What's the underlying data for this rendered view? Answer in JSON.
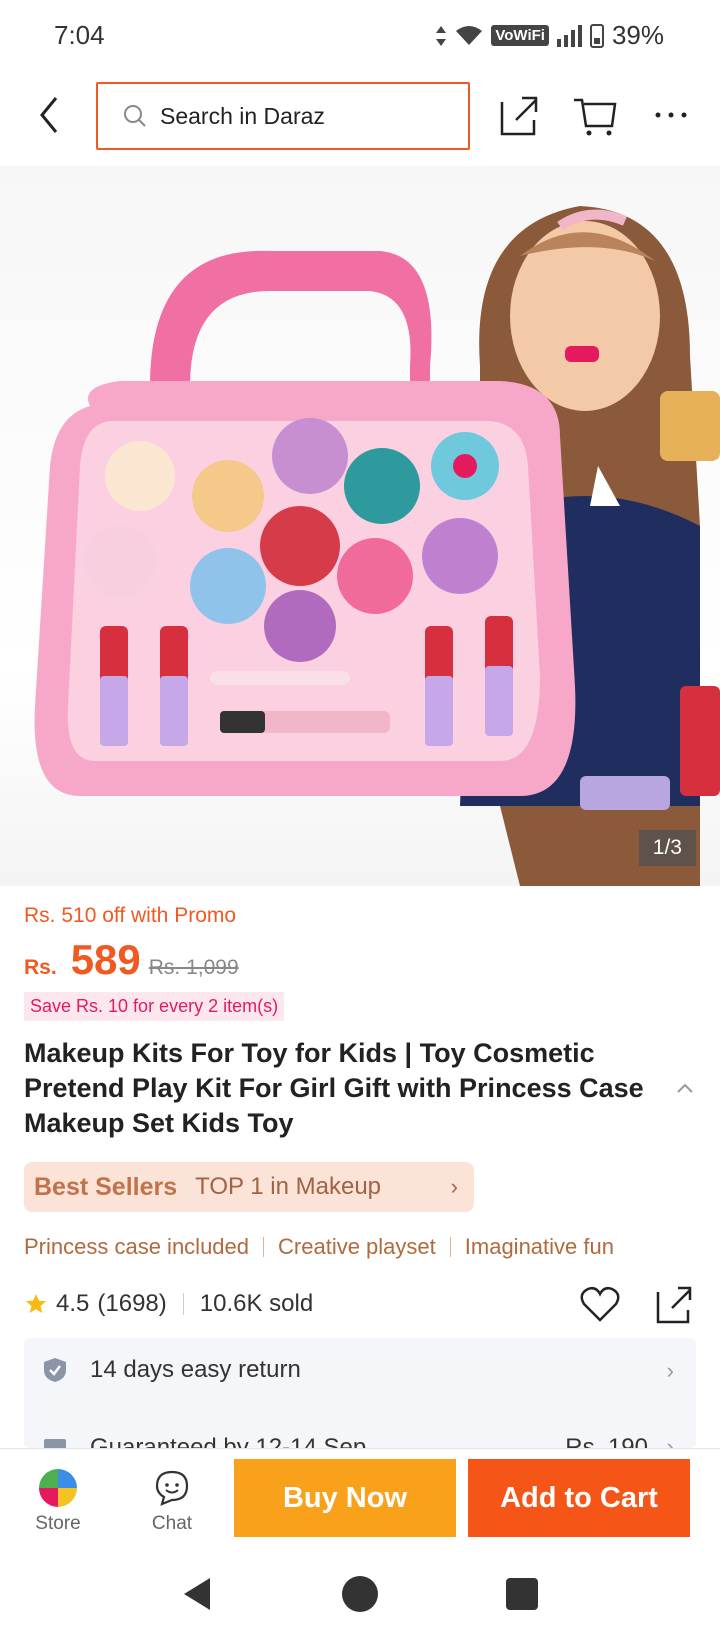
{
  "status": {
    "time": "7:04",
    "network": "VoWiFi",
    "battery": "39%"
  },
  "header": {
    "search_placeholder": "Search in Daraz"
  },
  "gallery": {
    "counter": "1/3"
  },
  "price": {
    "promo": "Rs. 510 off with Promo",
    "currency": "Rs.",
    "current": "589",
    "original": "Rs. 1,099",
    "save_chip": "Save Rs. 10 for every 2 item(s)"
  },
  "product": {
    "title": "Makeup Kits For Toy for Kids | Toy Cosmetic Pretend Play Kit For Girl Gift with Princess Case Makeup Set Kids Toy"
  },
  "best_seller": {
    "label": "Best Sellers",
    "rank": "TOP 1 in Makeup"
  },
  "tags": [
    "Princess case included",
    "Creative playset",
    "Imaginative fun"
  ],
  "rating": {
    "score": "4.5",
    "count": "(1698)",
    "sold": "10.6K sold"
  },
  "services": {
    "return": "14 days easy return",
    "delivery": "Guaranteed by 12-14 Sep",
    "delivery_fee": "Rs. 190"
  },
  "bottom": {
    "store": "Store",
    "chat": "Chat",
    "buy_now": "Buy Now",
    "add_to_cart": "Add to Cart"
  },
  "colors": {
    "accent": "#f05a22",
    "buy_now": "#f9a11b",
    "add_to_cart": "#f55617",
    "pink": "#e5195e"
  }
}
